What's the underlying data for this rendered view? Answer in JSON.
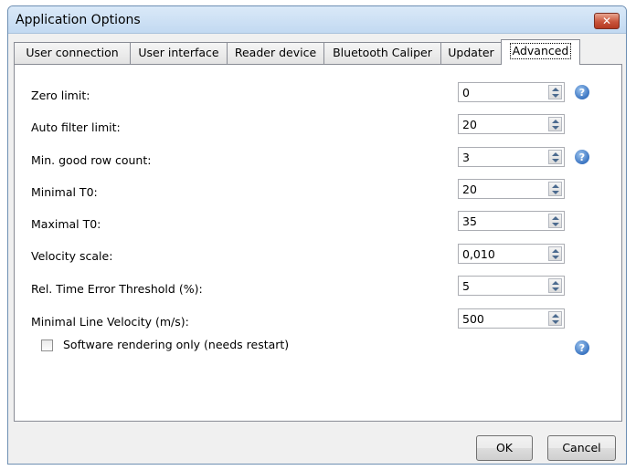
{
  "window": {
    "title": "Application Options",
    "close_glyph": "✕"
  },
  "tabs": [
    {
      "label": "User connection"
    },
    {
      "label": "User interface"
    },
    {
      "label": "Reader device"
    },
    {
      "label": "Bluetooth Caliper"
    },
    {
      "label": "Updater"
    },
    {
      "label": "Advanced",
      "active": true
    }
  ],
  "fields": [
    {
      "label": "Zero limit:",
      "value": "0",
      "help": true
    },
    {
      "label": "Auto filter limit:",
      "value": "20",
      "help": false
    },
    {
      "label": "Min. good row count:",
      "value": "3",
      "help": true
    },
    {
      "label": "Minimal T0:",
      "value": "20",
      "help": false
    },
    {
      "label": "Maximal T0:",
      "value": "35",
      "help": false
    },
    {
      "label": "Velocity scale:",
      "value": "0,010",
      "help": false
    },
    {
      "label": "Rel. Time Error Threshold (%):",
      "value": "5",
      "help": false
    },
    {
      "label": "Minimal Line Velocity (m/s):",
      "value": "500",
      "help": false
    }
  ],
  "software_rendering": {
    "label": "Software rendering only (needs restart)",
    "checked": false
  },
  "help_glyph": "?",
  "buttons": {
    "ok": "OK",
    "cancel": "Cancel"
  },
  "colors": {
    "help_icon": "#3a74c1",
    "close_button": "#c9553c"
  }
}
